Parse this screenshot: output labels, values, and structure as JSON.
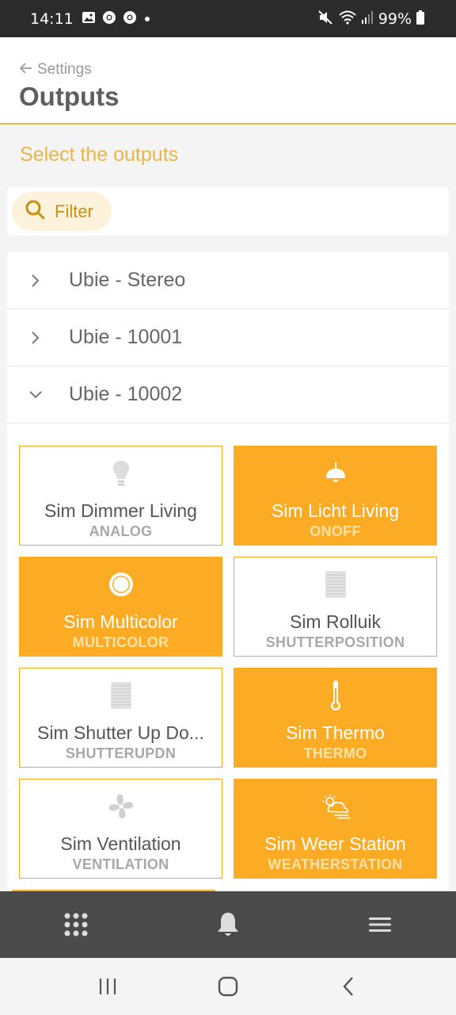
{
  "status_bar": {
    "time": "14:11",
    "battery": "99%",
    "left_icons": [
      "gallery-icon",
      "chrome-icon",
      "chrome-icon",
      "dot-icon"
    ],
    "right_icons": [
      "mute-icon",
      "wifi-icon",
      "signal-icon",
      "battery-icon"
    ]
  },
  "header": {
    "back_label": "Settings",
    "title": "Outputs"
  },
  "subtitle": "Select the outputs",
  "filter": {
    "label": "Filter"
  },
  "groups": [
    {
      "label": "Ubie - Stereo",
      "expanded": false
    },
    {
      "label": "Ubie - 10001",
      "expanded": false
    },
    {
      "label": "Ubie - 10002",
      "expanded": true
    }
  ],
  "outputs": [
    {
      "name": "Sim Dimmer Living",
      "type": "ANALOG",
      "selected": false,
      "icon": "bulb-icon"
    },
    {
      "name": "Sim Licht Living",
      "type": "ONOFF",
      "selected": true,
      "icon": "ceiling-lamp-icon"
    },
    {
      "name": "Sim Multicolor",
      "type": "MULTICOLOR",
      "selected": true,
      "icon": "color-circle-icon"
    },
    {
      "name": "Sim Rolluik",
      "type": "SHUTTERPOSITION",
      "selected": false,
      "icon": "shutter-icon"
    },
    {
      "name": "Sim Shutter Up Do...",
      "type": "SHUTTERUPDN",
      "selected": false,
      "icon": "shutter-icon"
    },
    {
      "name": "Sim Thermo",
      "type": "THERMO",
      "selected": true,
      "icon": "thermometer-icon"
    },
    {
      "name": "Sim Ventilation",
      "type": "VENTILATION",
      "selected": false,
      "icon": "fan-icon"
    },
    {
      "name": "Sim Weer Station",
      "type": "WEATHERSTATION",
      "selected": true,
      "icon": "weather-icon"
    }
  ],
  "colors": {
    "accent": "#fbab24",
    "accent_text": "#e8b547",
    "bottom_nav": "#4a4a4a"
  },
  "bottom_nav": [
    "grid-icon",
    "bell-icon",
    "menu-icon"
  ],
  "system_nav": [
    "recents-icon",
    "home-icon",
    "back-icon"
  ]
}
